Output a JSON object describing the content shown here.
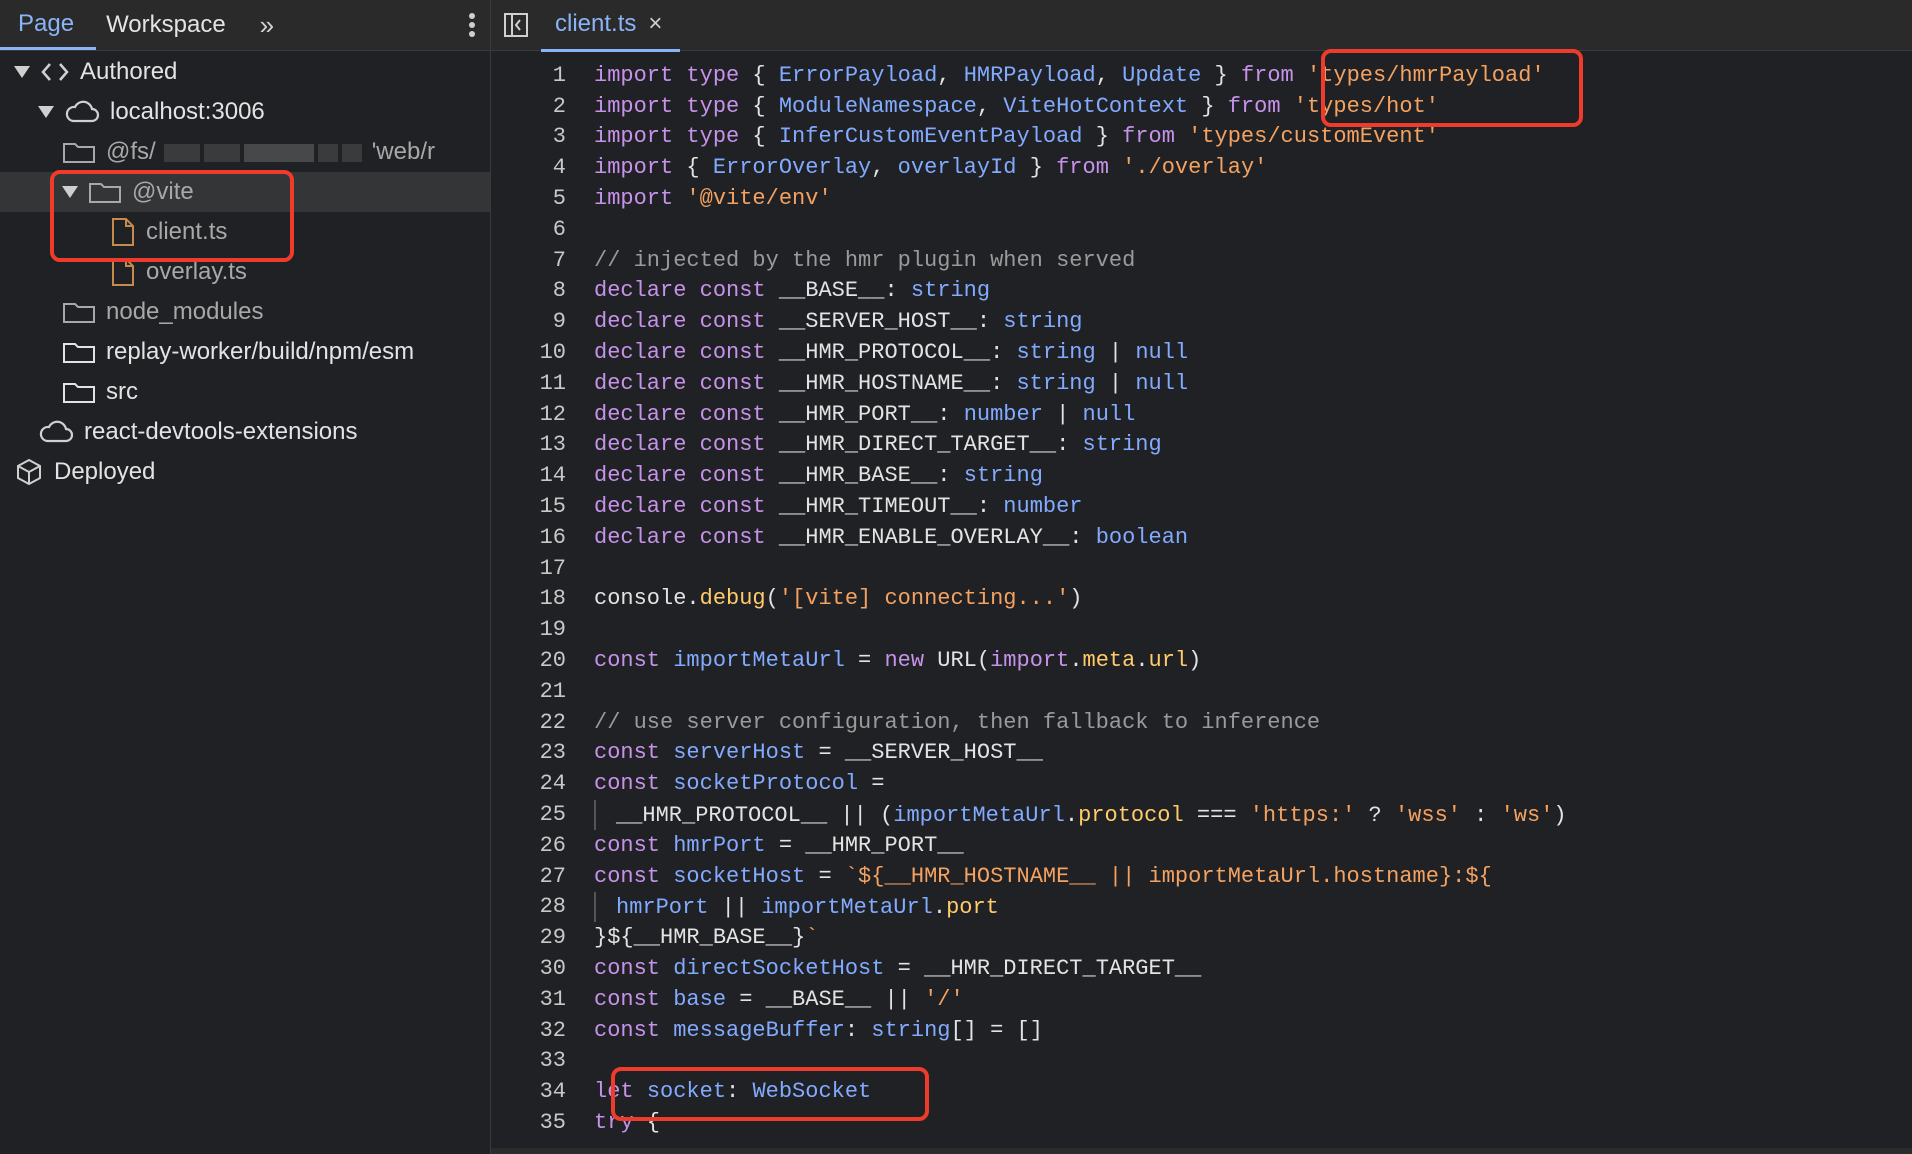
{
  "left_tabs": {
    "tabs": [
      {
        "label": "Page",
        "active": true
      },
      {
        "label": "Workspace",
        "active": false
      }
    ],
    "more_glyph": "»"
  },
  "file_tree": {
    "items": [
      {
        "label": "Authored",
        "level": 0,
        "expanded": true,
        "icon": "code-icon",
        "kind": "section"
      },
      {
        "label": "localhost:3006",
        "level": 1,
        "expanded": true,
        "icon": "cloud-icon",
        "kind": "host"
      },
      {
        "label": "@fs/",
        "level": 2,
        "expanded": false,
        "icon": "folder-icon",
        "kind": "folder",
        "suffix": "'web/r"
      },
      {
        "label": "@vite",
        "level": 2,
        "expanded": true,
        "icon": "folder-icon",
        "kind": "folder",
        "selected": true
      },
      {
        "label": "client.ts",
        "level": 3,
        "icon": "file-icon",
        "kind": "file"
      },
      {
        "label": "overlay.ts",
        "level": 3,
        "icon": "file-icon",
        "kind": "file"
      },
      {
        "label": "node_modules",
        "level": 2,
        "expanded": false,
        "icon": "folder-icon",
        "kind": "folder"
      },
      {
        "label": "replay-worker/build/npm/esm",
        "level": 2,
        "expanded": false,
        "icon": "folder-icon",
        "kind": "folder"
      },
      {
        "label": "src",
        "level": 2,
        "expanded": false,
        "icon": "folder-icon",
        "kind": "folder"
      },
      {
        "label": "react-devtools-extensions",
        "level": 1,
        "expanded": false,
        "icon": "cloud-icon",
        "kind": "host"
      },
      {
        "label": "Deployed",
        "level": 0,
        "expanded": false,
        "icon": "cube-icon",
        "kind": "section"
      }
    ]
  },
  "editor": {
    "tab_label": "client.ts",
    "close_glyph": "×",
    "lines": [
      {
        "n": "1",
        "t": "import type { ErrorPayload, HMRPayload, Update } from 'types/hmrPayload'"
      },
      {
        "n": "2",
        "t": "import type { ModuleNamespace, ViteHotContext } from 'types/hot'"
      },
      {
        "n": "3",
        "t": "import type { InferCustomEventPayload } from 'types/customEvent'"
      },
      {
        "n": "4",
        "t": "import { ErrorOverlay, overlayId } from './overlay'"
      },
      {
        "n": "5",
        "t": "import '@vite/env'"
      },
      {
        "n": "6",
        "t": ""
      },
      {
        "n": "7",
        "t": "// injected by the hmr plugin when served"
      },
      {
        "n": "8",
        "t": "declare const __BASE__: string"
      },
      {
        "n": "9",
        "t": "declare const __SERVER_HOST__: string"
      },
      {
        "n": "10",
        "t": "declare const __HMR_PROTOCOL__: string | null"
      },
      {
        "n": "11",
        "t": "declare const __HMR_HOSTNAME__: string | null"
      },
      {
        "n": "12",
        "t": "declare const __HMR_PORT__: number | null"
      },
      {
        "n": "13",
        "t": "declare const __HMR_DIRECT_TARGET__: string"
      },
      {
        "n": "14",
        "t": "declare const __HMR_BASE__: string"
      },
      {
        "n": "15",
        "t": "declare const __HMR_TIMEOUT__: number"
      },
      {
        "n": "16",
        "t": "declare const __HMR_ENABLE_OVERLAY__: boolean"
      },
      {
        "n": "17",
        "t": ""
      },
      {
        "n": "18",
        "t": "console.debug('[vite] connecting...')"
      },
      {
        "n": "19",
        "t": ""
      },
      {
        "n": "20",
        "t": "const importMetaUrl = new URL(import.meta.url)"
      },
      {
        "n": "21",
        "t": ""
      },
      {
        "n": "22",
        "t": "// use server configuration, then fallback to inference"
      },
      {
        "n": "23",
        "t": "const serverHost = __SERVER_HOST__"
      },
      {
        "n": "24",
        "t": "const socketProtocol ="
      },
      {
        "n": "25",
        "t": "  __HMR_PROTOCOL__ || (importMetaUrl.protocol === 'https:' ? 'wss' : 'ws')"
      },
      {
        "n": "26",
        "t": "const hmrPort = __HMR_PORT__"
      },
      {
        "n": "27",
        "t": "const socketHost = `${__HMR_HOSTNAME__ || importMetaUrl.hostname}:${"
      },
      {
        "n": "28",
        "t": "  hmrPort || importMetaUrl.port"
      },
      {
        "n": "29",
        "t": "}${__HMR_BASE__}`"
      },
      {
        "n": "30",
        "t": "const directSocketHost = __HMR_DIRECT_TARGET__"
      },
      {
        "n": "31",
        "t": "const base = __BASE__ || '/'"
      },
      {
        "n": "32",
        "t": "const messageBuffer: string[] = []"
      },
      {
        "n": "33",
        "t": ""
      },
      {
        "n": "34",
        "t": "let socket: WebSocket"
      },
      {
        "n": "35",
        "t": "try {"
      }
    ]
  },
  "colors": {
    "accent": "#8ab4f8",
    "highlight": "#ef3b2c"
  }
}
